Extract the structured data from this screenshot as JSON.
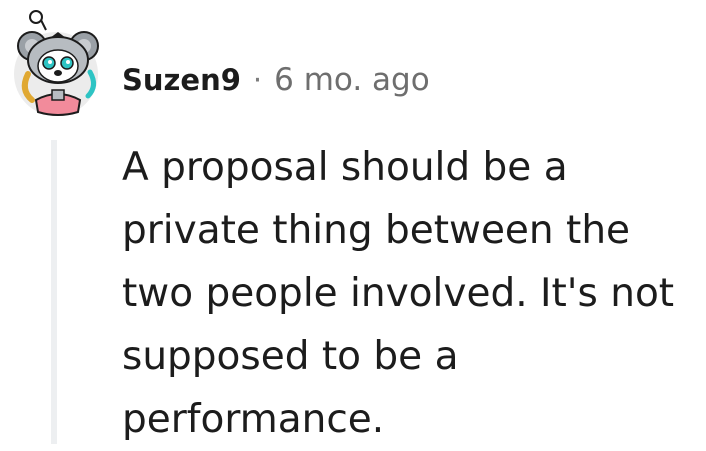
{
  "comment": {
    "author": "Suzen9",
    "separator": "·",
    "timestamp": "6 mo. ago",
    "body": "A proposal should be a private thing between the two people involved. It's not supposed to be a performance."
  },
  "icons": {
    "avatar": "snoo-koala-avatar-icon"
  }
}
